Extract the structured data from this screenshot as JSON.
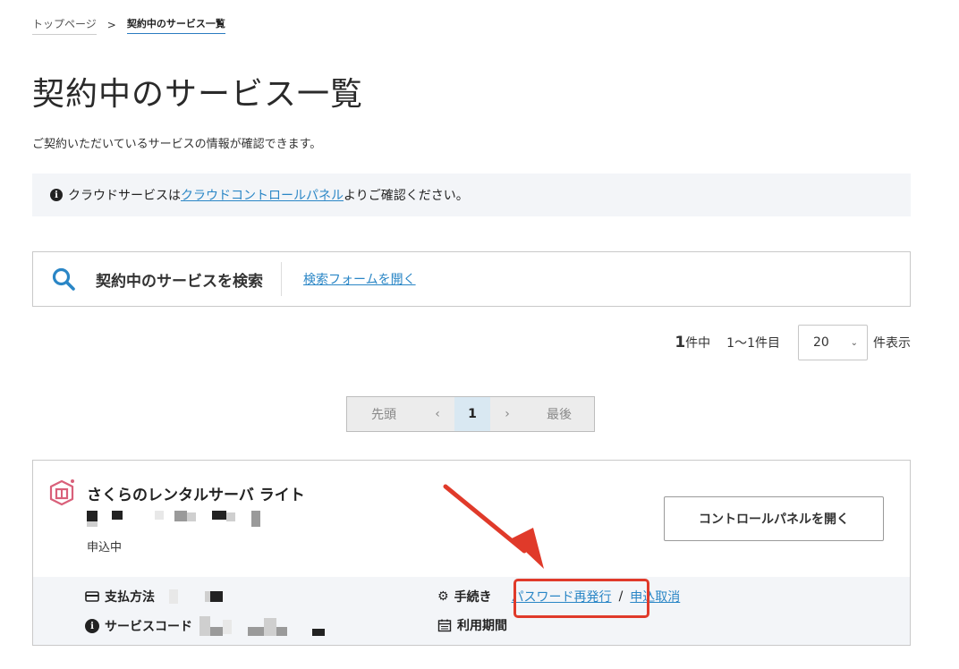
{
  "breadcrumb": {
    "home": "トップページ",
    "separator": ">",
    "current": "契約中のサービス一覧"
  },
  "page": {
    "title": "契約中のサービス一覧",
    "description": "ご契約いただいているサービスの情報が確認できます。"
  },
  "info": {
    "icon": "info-circle-icon",
    "prefix": "クラウドサービスは",
    "link": "クラウドコントロールパネル",
    "suffix": "よりご確認ください。"
  },
  "search": {
    "icon": "search-icon",
    "title": "契約中のサービスを検索",
    "open_link": "検索フォームを開く"
  },
  "count": {
    "total": "1",
    "total_suffix": "件中",
    "range": "1〜1件目",
    "per_page": "20",
    "per_page_suffix": "件表示"
  },
  "pager": {
    "first": "先頭",
    "prev": "‹",
    "current": "1",
    "next": "›",
    "last": "最後"
  },
  "service": {
    "name": "さくらのレンタルサーバ ライト",
    "status": "申込中",
    "control_panel_button": "コントロールパネルを開く",
    "payment_label": "支払方法",
    "service_code_label": "サービスコード",
    "procedure_label": "手続き",
    "password_reissue_link": "パスワード再発行",
    "link_separator": "/",
    "cancel_link": "申込取消",
    "period_label": "利用期間"
  },
  "colors": {
    "accent_link": "#2a86c6",
    "highlight": "#e03a2a",
    "icon_pink": "#d9607a"
  }
}
